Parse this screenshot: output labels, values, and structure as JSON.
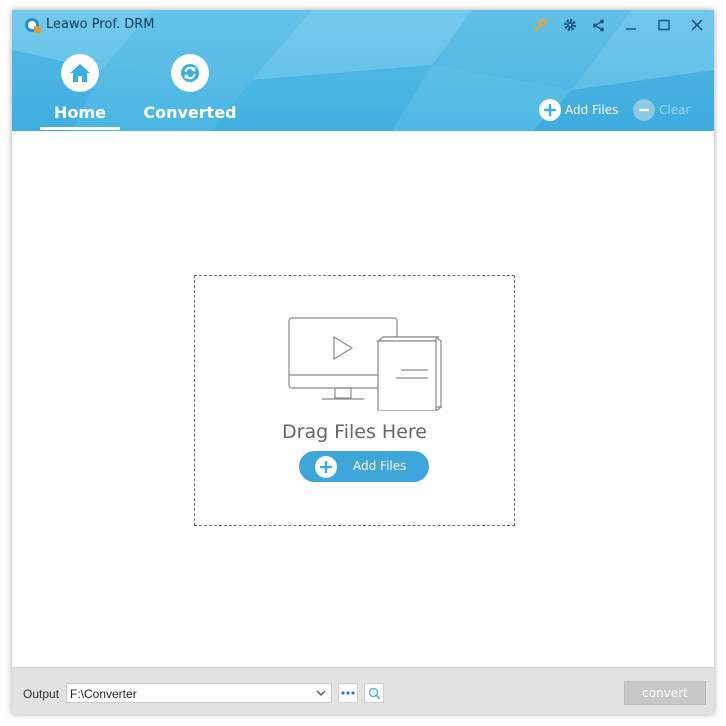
{
  "app": {
    "title": "Leawo Prof. DRM"
  },
  "titlebar": {
    "buttons": [
      {
        "icon": "key-icon"
      },
      {
        "icon": "gear-icon"
      },
      {
        "icon": "share-icon"
      },
      {
        "icon": "minimize-icon"
      },
      {
        "icon": "maximize-icon"
      },
      {
        "icon": "close-icon"
      }
    ]
  },
  "tabs": [
    {
      "label": "Home",
      "icon": "home-icon",
      "active": true
    },
    {
      "label": "Converted",
      "icon": "refresh-icon",
      "active": false
    }
  ],
  "header_actions": {
    "add_files": "Add Files",
    "clear": "Clear"
  },
  "dropzone": {
    "text": "Drag Files Here",
    "add_files": "Add Files",
    "illustration": "monitor-and-book-icon"
  },
  "bottom": {
    "output_label": "Output",
    "output_path": "F:\\Converter",
    "convert_label": "convert"
  },
  "colors": {
    "header_blue": "#4fb8e3",
    "accent": "#3ea6d9",
    "key_icon": "#f0a030",
    "disabled": "#c8c8c8"
  }
}
